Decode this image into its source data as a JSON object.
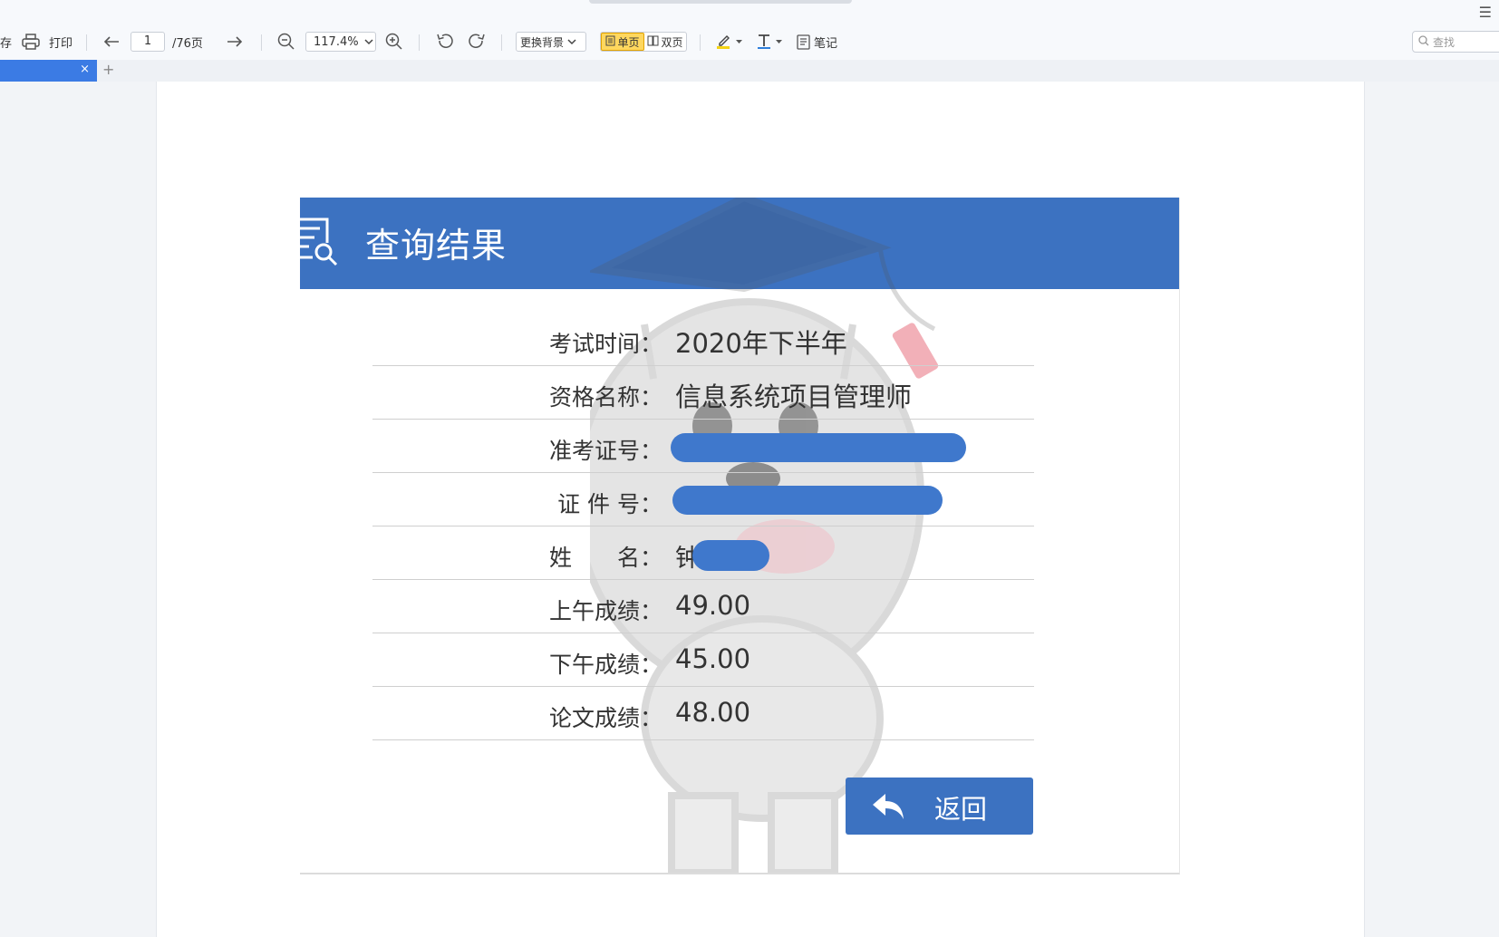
{
  "toolbar": {
    "save_partial": "存",
    "print_label": "打印",
    "page_current": "1",
    "page_total": "/76页",
    "zoom": "117.4%",
    "background_label": "更换背景",
    "view_single": "单页",
    "view_double": "双页",
    "note_label": "笔记",
    "search_placeholder": "查找",
    "menu_glyph": "☰"
  },
  "tabs": {
    "close_glyph": "×",
    "new_glyph": "+"
  },
  "result": {
    "title": "查询结果",
    "rows": [
      {
        "label": "考试时间：",
        "value": "2020年下半年"
      },
      {
        "label": "资格名称：",
        "value": "信息系统项目管理师"
      },
      {
        "label": "准考证号：",
        "value": ""
      },
      {
        "label": "证 件 号：",
        "value": ""
      },
      {
        "label": "姓　　名：",
        "value": "钟"
      },
      {
        "label": "上午成绩：",
        "value": "49.00"
      },
      {
        "label": "下午成绩：",
        "value": "45.00"
      },
      {
        "label": "论文成绩：",
        "value": "48.00"
      }
    ],
    "back_label": "返回"
  },
  "colors": {
    "header_blue": "#3c72c1",
    "tab_active": "#3b7be4",
    "view_active": "#ffd75e",
    "redaction": "#3f78cc"
  },
  "icons": [
    "print-icon",
    "arrow-left-icon",
    "arrow-right-icon",
    "zoom-out-icon",
    "zoom-in-icon",
    "rotate-left-icon",
    "rotate-right-icon",
    "highlighter-icon",
    "text-icon",
    "note-icon",
    "search-icon",
    "reply-arrow-icon",
    "document-search-icon"
  ]
}
